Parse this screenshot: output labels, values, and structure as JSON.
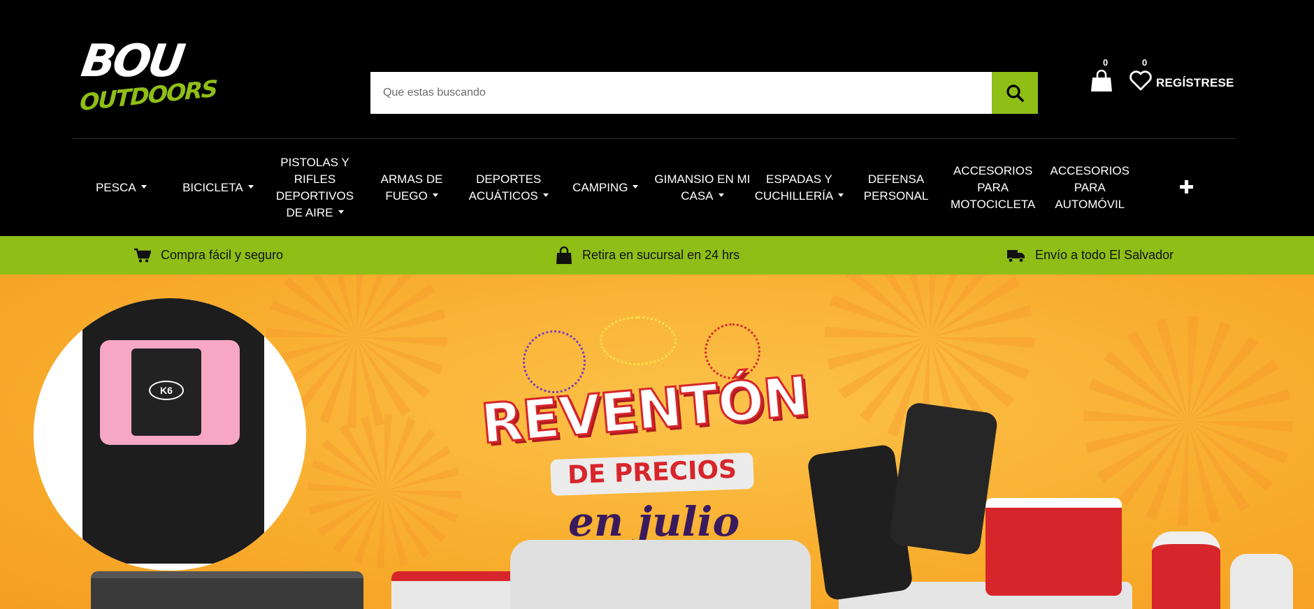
{
  "brand": {
    "line1": "BOU",
    "line2": "OUTDOORS"
  },
  "search": {
    "placeholder": "Que estas buscando"
  },
  "header": {
    "cart_count": "0",
    "wishlist_count": "0",
    "register_label": "REGÍSTRESE"
  },
  "nav": {
    "items": [
      {
        "label": "PESCA",
        "dropdown": true
      },
      {
        "label": "BICICLETA",
        "dropdown": true
      },
      {
        "label": "PISTOLAS Y RIFLES DEPORTIVOS DE AIRE",
        "dropdown": true
      },
      {
        "label": "ARMAS DE FUEGO",
        "dropdown": true
      },
      {
        "label": "DEPORTES ACUÁTICOS",
        "dropdown": true
      },
      {
        "label": "CAMPING",
        "dropdown": true
      },
      {
        "label": "GIMANSIO EN MI CASA",
        "dropdown": true
      },
      {
        "label": "ESPADAS Y CUCHILLERÍA",
        "dropdown": true
      },
      {
        "label": "DEFENSA PERSONAL",
        "dropdown": false
      },
      {
        "label": "ACCESORIOS PARA MOTOCICLETA",
        "dropdown": false
      },
      {
        "label": "ACCESORIOS PARA AUTOMÓVIL",
        "dropdown": false
      }
    ],
    "more_label": "✚"
  },
  "infobar": {
    "items": [
      {
        "icon": "cart-icon",
        "label": "Compra fácil y seguro"
      },
      {
        "icon": "shopping-bag-icon",
        "label": "Retira en sucursal en 24 hrs"
      },
      {
        "icon": "truck-icon",
        "label": "Envío a todo El Salvador"
      }
    ]
  },
  "hero": {
    "title": "REVENTÓN",
    "subtitle": "DE PRECIOS",
    "script": "en julio",
    "belt_logo": "K6"
  },
  "colors": {
    "accent": "#8fbe17",
    "hero_bg": "#f8ac2c",
    "title_red": "#d7262b",
    "script_purple": "#3a1a5e"
  }
}
